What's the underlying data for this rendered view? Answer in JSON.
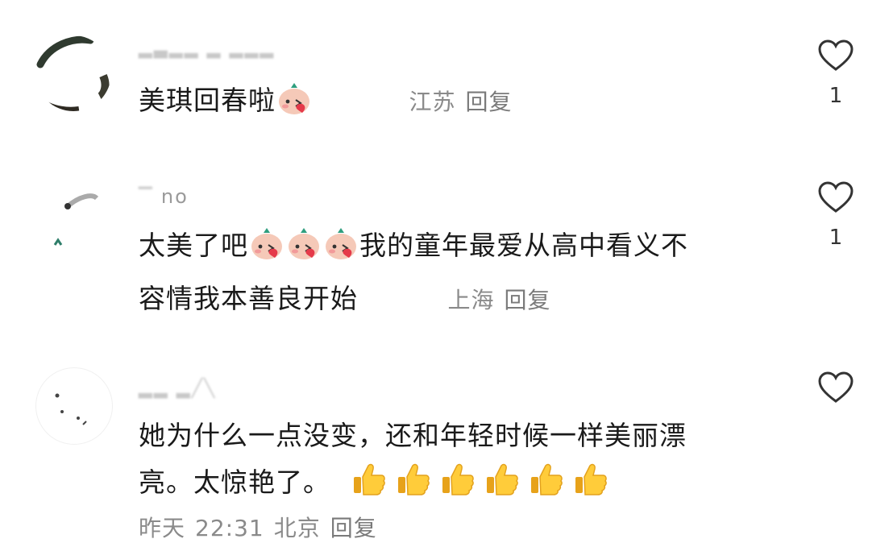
{
  "comments": [
    {
      "username": "",
      "text": "美琪回春啦",
      "emoji_name": "shy-face-emoji",
      "location": "江苏",
      "reply_label": "回复",
      "likes": "1"
    },
    {
      "username": "no",
      "text_line1": "太美了吧",
      "text_line1_after": "我的童年最爱从高中看义不",
      "text_line2": "容情我本善良开始",
      "emoji_name": "shy-face-emoji",
      "emoji_count": 3,
      "location": "上海",
      "reply_label": "回复",
      "likes": "1"
    },
    {
      "username": "",
      "text_line1": "她为什么一点没变，还和年轻时候一样美丽漂",
      "text_line2": "亮。太惊艳了。",
      "emoji_name": "thumbs-up-emoji",
      "emoji_count": 6,
      "date": "昨天",
      "time": "22:31",
      "location": "北京",
      "reply_label": "回复"
    }
  ],
  "icons": {
    "like": "heart-outline-icon"
  },
  "colors": {
    "text": "#1a1a1a",
    "meta": "#8a8a8a",
    "heart_stroke": "#333333"
  }
}
